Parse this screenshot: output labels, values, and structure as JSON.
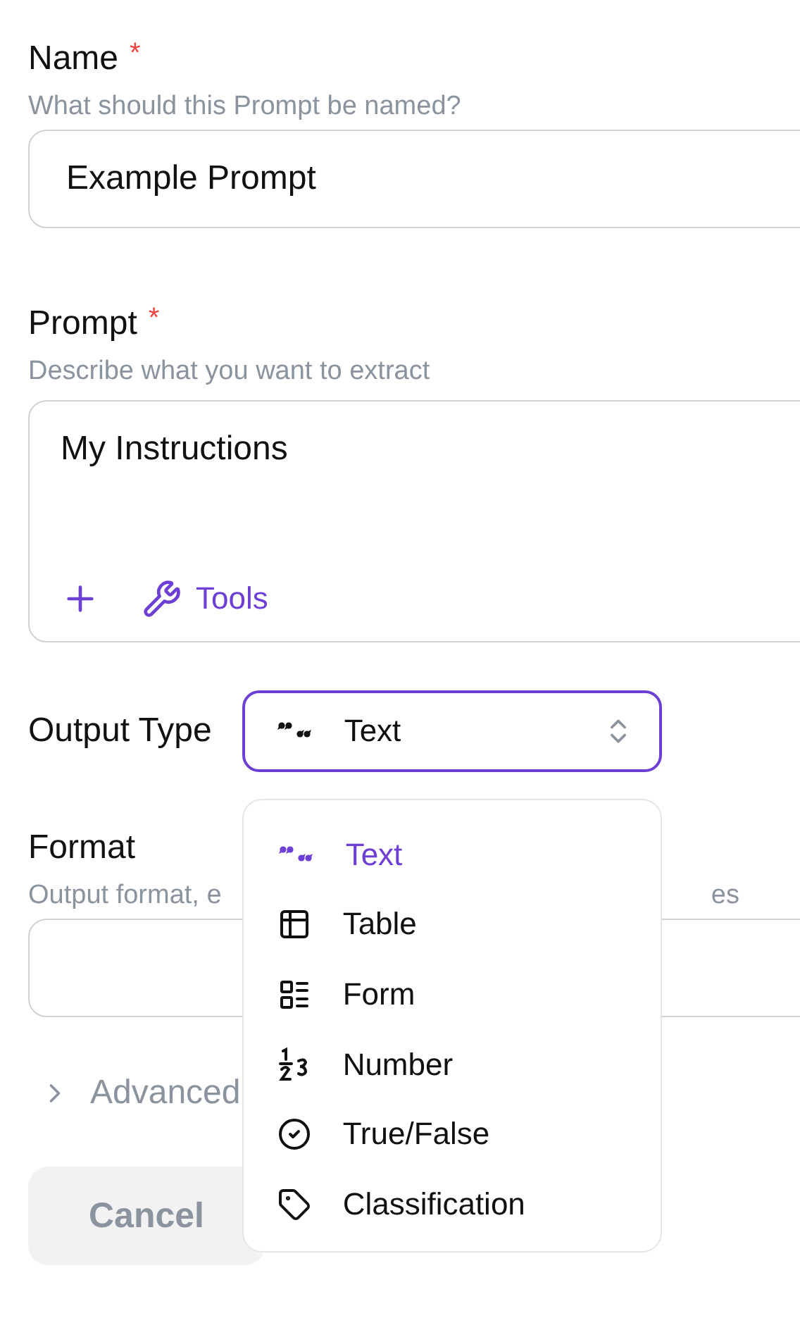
{
  "name_field": {
    "label": "Name",
    "required_mark": "*",
    "hint": "What should this Prompt be named?",
    "value": "Example Prompt"
  },
  "prompt_field": {
    "label": "Prompt",
    "required_mark": "*",
    "hint": "Describe what you want to extract",
    "value": "My Instructions",
    "tools_label": "Tools"
  },
  "output_type": {
    "label": "Output Type",
    "value": "Text",
    "expanded": true,
    "options": [
      {
        "label": "Text",
        "kind": "text",
        "selected": true
      },
      {
        "label": "Table",
        "kind": "table",
        "selected": false
      },
      {
        "label": "Form",
        "kind": "form",
        "selected": false
      },
      {
        "label": "Number",
        "kind": "number",
        "selected": false
      },
      {
        "label": "True/False",
        "kind": "boolean",
        "selected": false
      },
      {
        "label": "Classification",
        "kind": "classification",
        "selected": false
      }
    ]
  },
  "format_field": {
    "label": "Format",
    "hint_start": "Output format, e",
    "hint_end": "es"
  },
  "advanced": {
    "label": "Advanced",
    "expanded": false
  },
  "buttons": [
    {
      "label": "Cancel",
      "disabled": true
    }
  ]
}
